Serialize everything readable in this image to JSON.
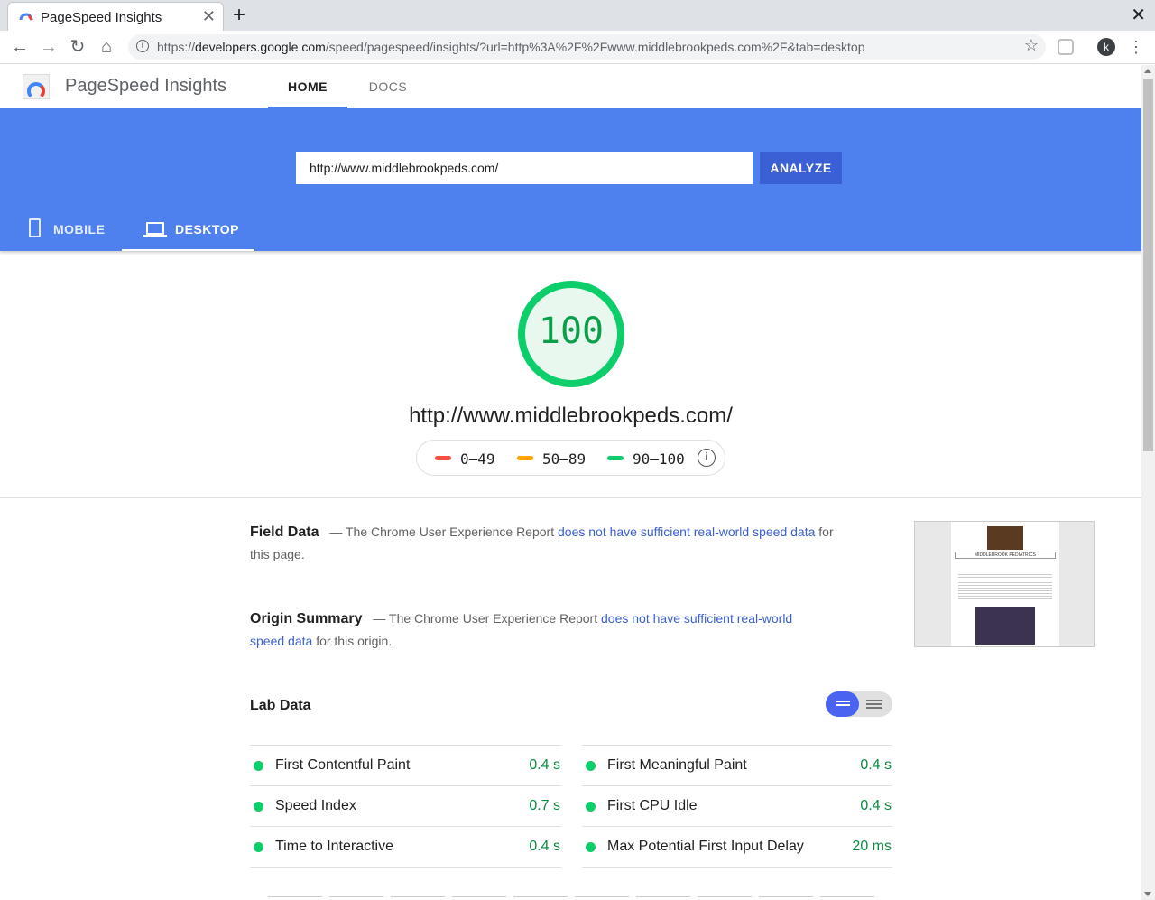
{
  "browser": {
    "tab_title": "PageSpeed Insights",
    "url_domain": "developers.google.com",
    "url_prefix": "https://",
    "url_path": "/speed/pagespeed/insights/?url=http%3A%2F%2Fwww.middlebrookpeds.com%2F&tab=desktop",
    "avatar_letter": "k"
  },
  "header": {
    "title": "PageSpeed Insights",
    "nav": [
      "HOME",
      "DOCS"
    ]
  },
  "search": {
    "value": "http://www.middlebrookpeds.com/",
    "analyze_label": "ANALYZE"
  },
  "devices": [
    "MOBILE",
    "DESKTOP"
  ],
  "score": {
    "value": "100",
    "url": "http://www.middlebrookpeds.com/",
    "legend": [
      {
        "label": "0–49",
        "color": "#ff4e42"
      },
      {
        "label": "50–89",
        "color": "#ffa400"
      },
      {
        "label": "90–100",
        "color": "#0cce6b"
      }
    ]
  },
  "field_data": {
    "heading": "Field Data",
    "dash": "—",
    "text_before": "The Chrome User Experience Report",
    "link": "does not have sufficient real-world speed data",
    "text_after": "for this page."
  },
  "origin_summary": {
    "heading": "Origin Summary",
    "dash": "—",
    "text_before": "The Chrome User Experience Report",
    "link": "does not have sufficient real-world speed data",
    "text_after": "for this origin."
  },
  "thumbnail": {
    "site_title": "MIDDLEBROOK PEDIATRICS"
  },
  "lab_data": {
    "title": "Lab Data",
    "left": [
      {
        "name": "First Contentful Paint",
        "value": "0.4 s"
      },
      {
        "name": "Speed Index",
        "value": "0.7 s"
      },
      {
        "name": "Time to Interactive",
        "value": "0.4 s"
      }
    ],
    "right": [
      {
        "name": "First Meaningful Paint",
        "value": "0.4 s"
      },
      {
        "name": "First CPU Idle",
        "value": "0.4 s"
      },
      {
        "name": "Max Potential First Input Delay",
        "value": "20 ms"
      }
    ]
  },
  "colors": {
    "brand_blue": "#4e80ee",
    "pass_green": "#0cce6b",
    "link_blue": "#3b5fd4"
  }
}
